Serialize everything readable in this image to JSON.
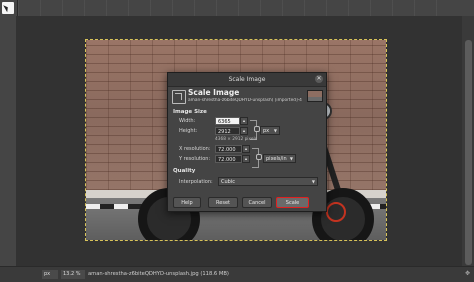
{
  "dialog": {
    "title": "Scale Image",
    "close_glyph": "✕",
    "header_title": "Scale Image",
    "header_subtitle": "aman-shrestha-z6biteQDHYD-unsplash) [imported]-4",
    "image_size_label": "Image Size",
    "width_label": "Width:",
    "width_value": "6365",
    "height_label": "Height:",
    "height_value": "2912",
    "size_unit": "px",
    "pixel_info": "4368 × 2912 pixels",
    "xres_label": "X resolution:",
    "xres_value": "72.000",
    "yres_label": "Y resolution:",
    "yres_value": "72.000",
    "res_unit": "pixels/in",
    "quality_label": "Quality",
    "interp_label": "Interpolation:",
    "interp_value": "Cubic",
    "buttons": {
      "help": "Help",
      "reset": "Reset",
      "cancel": "Cancel",
      "scale": "Scale"
    }
  },
  "statusbar": {
    "unit": "px",
    "zoom": "13.2 %",
    "text": "aman-shrestha-z6biteQDHYD-unsplash.jpg (118.6 MB)"
  },
  "colors": {
    "highlight": "#e02020",
    "dialog_bg": "#444444"
  }
}
